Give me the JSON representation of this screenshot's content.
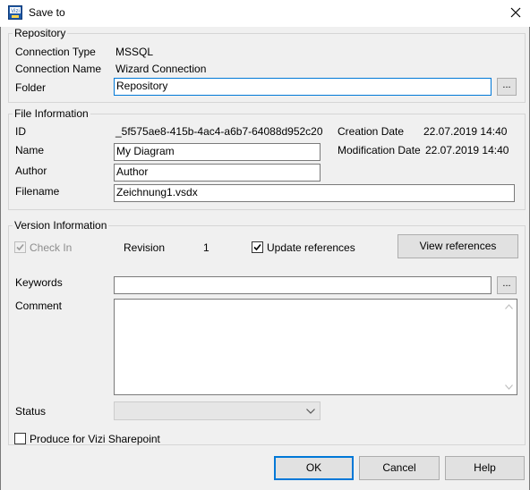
{
  "window": {
    "title": "Save to",
    "close_glyph": "✕"
  },
  "repository": {
    "legend": "Repository",
    "connection_type_label": "Connection Type",
    "connection_type_value": "MSSQL",
    "connection_name_label": "Connection Name",
    "connection_name_value": "Wizard Connection",
    "folder_label": "Folder",
    "folder_value": "Repository",
    "browse_label": "..."
  },
  "file_info": {
    "legend": "File Information",
    "id_label": "ID",
    "id_value": "_5f575ae8-415b-4ac4-a6b7-64088d952c20",
    "creation_date_label": "Creation Date",
    "creation_date_value": "22.07.2019 14:40",
    "modification_date_label": "Modification Date",
    "modification_date_value": "22.07.2019 14:40",
    "name_label": "Name",
    "name_value": "My Diagram",
    "author_label": "Author",
    "author_value": "Author",
    "filename_label": "Filename",
    "filename_value": "Zeichnung1.vsdx"
  },
  "version_info": {
    "legend": "Version Information",
    "check_in_label": "Check In",
    "check_in_checked": true,
    "check_in_enabled": false,
    "revision_label": "Revision",
    "revision_value": "1",
    "update_references_label": "Update references",
    "update_references_checked": true,
    "view_references_label": "View references",
    "keywords_label": "Keywords",
    "keywords_value": "",
    "keywords_browse_label": "...",
    "comment_label": "Comment",
    "comment_value": "",
    "status_label": "Status",
    "status_value": ""
  },
  "produce_sharepoint_label": "Produce for Vizi Sharepoint",
  "produce_sharepoint_checked": false,
  "buttons": {
    "ok": "OK",
    "cancel": "Cancel",
    "help": "Help"
  },
  "colors": {
    "focus_border": "#0078d7",
    "app_icon": "#1e5aa8",
    "disabled_text": "#8d8d8d"
  },
  "icons": {
    "app": "vizi-app-icon",
    "close": "close-icon",
    "checkmark": "checkmark-icon",
    "dropdown": "chevron-down-icon",
    "scroll_up": "scroll-up-icon",
    "scroll_down": "scroll-down-icon"
  }
}
